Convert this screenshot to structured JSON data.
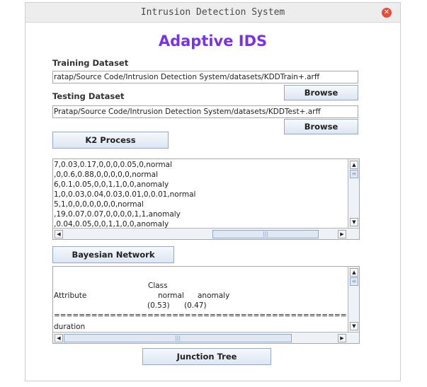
{
  "window": {
    "title": "Intrusion Detection System"
  },
  "app_title": "Adaptive IDS",
  "training": {
    "label": "Training Dataset",
    "path": "ratap/Source Code/Intrusion Detection System/datasets/KDDTrain+.arff",
    "browse_label": "Browse"
  },
  "testing": {
    "label": "Testing Dataset",
    "path": "Pratap/Source Code/Intrusion Detection System/datasets/KDDTest+.arff",
    "browse_label": "Browse"
  },
  "k2_label": "K2 Process",
  "output_lines": [
    "7,0.03,0.17,0,0,0,0.05,0,normal",
    ",0,0.6,0.88,0,0,0,0,0,normal",
    "6,0.1,0.05,0,0,1,1,0,0,anomaly",
    "1,0,0.03,0.04,0.03,0.01,0,0.01,normal",
    "5,1,0,0,0,0,0,0,0,normal",
    ",19,0.07,0.07,0,0,0,0,1,1,anomaly",
    ",0.04,0.05,0,0,1,1,0,0,anomaly"
  ],
  "bayes_label": "Bayesian Network",
  "bayes_table": {
    "class_header": "Class",
    "attribute_label": "Attribute",
    "col_normal": "normal",
    "col_anomaly": "anomaly",
    "prob_normal": "(0.53)",
    "prob_anomaly": "(0.47)",
    "separator": "==================================================",
    "first_attr": "duration"
  },
  "junction_label": "Junction Tree",
  "icons": {
    "close": "close-icon",
    "up": "up-arrow-icon",
    "down": "down-arrow-icon",
    "left": "left-arrow-icon",
    "right": "right-arrow-icon"
  }
}
